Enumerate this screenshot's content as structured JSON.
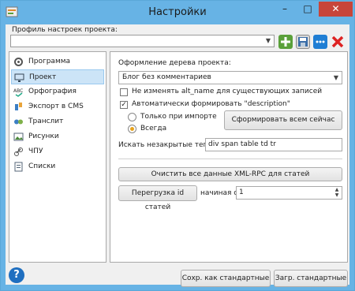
{
  "window": {
    "title": "Настройки",
    "min_glyph": "–",
    "max_glyph": "□",
    "close_glyph": "✕"
  },
  "profile": {
    "label": "Профиль настроек проекта:",
    "value": ""
  },
  "toolbar": {
    "tools": [
      "add-icon",
      "save-icon",
      "more-icon",
      "delete-icon"
    ]
  },
  "nav": {
    "items": [
      {
        "label": "Программа"
      },
      {
        "label": "Проект"
      },
      {
        "label": "Орфография"
      },
      {
        "label": "Экспорт в CMS"
      },
      {
        "label": "Транслит"
      },
      {
        "label": "Рисунки"
      },
      {
        "label": "ЧПУ"
      },
      {
        "label": "Списки"
      }
    ],
    "selected": "Проект"
  },
  "project": {
    "tree_label": "Оформление дерева проекта:",
    "tree_value": "Блог без комментариев",
    "alt_name_label": "Не изменять alt_name для существующих записей",
    "alt_name_checked": false,
    "auto_desc_label": "Автоматически формировать \"description\"",
    "auto_desc_checked": true,
    "radio_import_label": "Только при импорте",
    "radio_always_label": "Всегда",
    "radio_selected": "Всегда",
    "form_now_button": "Сформировать всем сейчас",
    "unclosed_tags_label": "Искать незакрытые теги:",
    "unclosed_tags_value": "div span table td tr",
    "clear_xmlrpc_button": "Очистить все данные XML-RPC для статей",
    "reload_ids_button": "Перегрузка id статей",
    "starting_label": "начиная с",
    "starting_value": "1"
  },
  "footer": {
    "save_default_button": "Сохр. как стандартные",
    "load_default_button": "Загр. стандартные"
  },
  "colors": {
    "accent": "#67b3e5",
    "selection": "#cce4f7",
    "close": "#c7453a"
  }
}
